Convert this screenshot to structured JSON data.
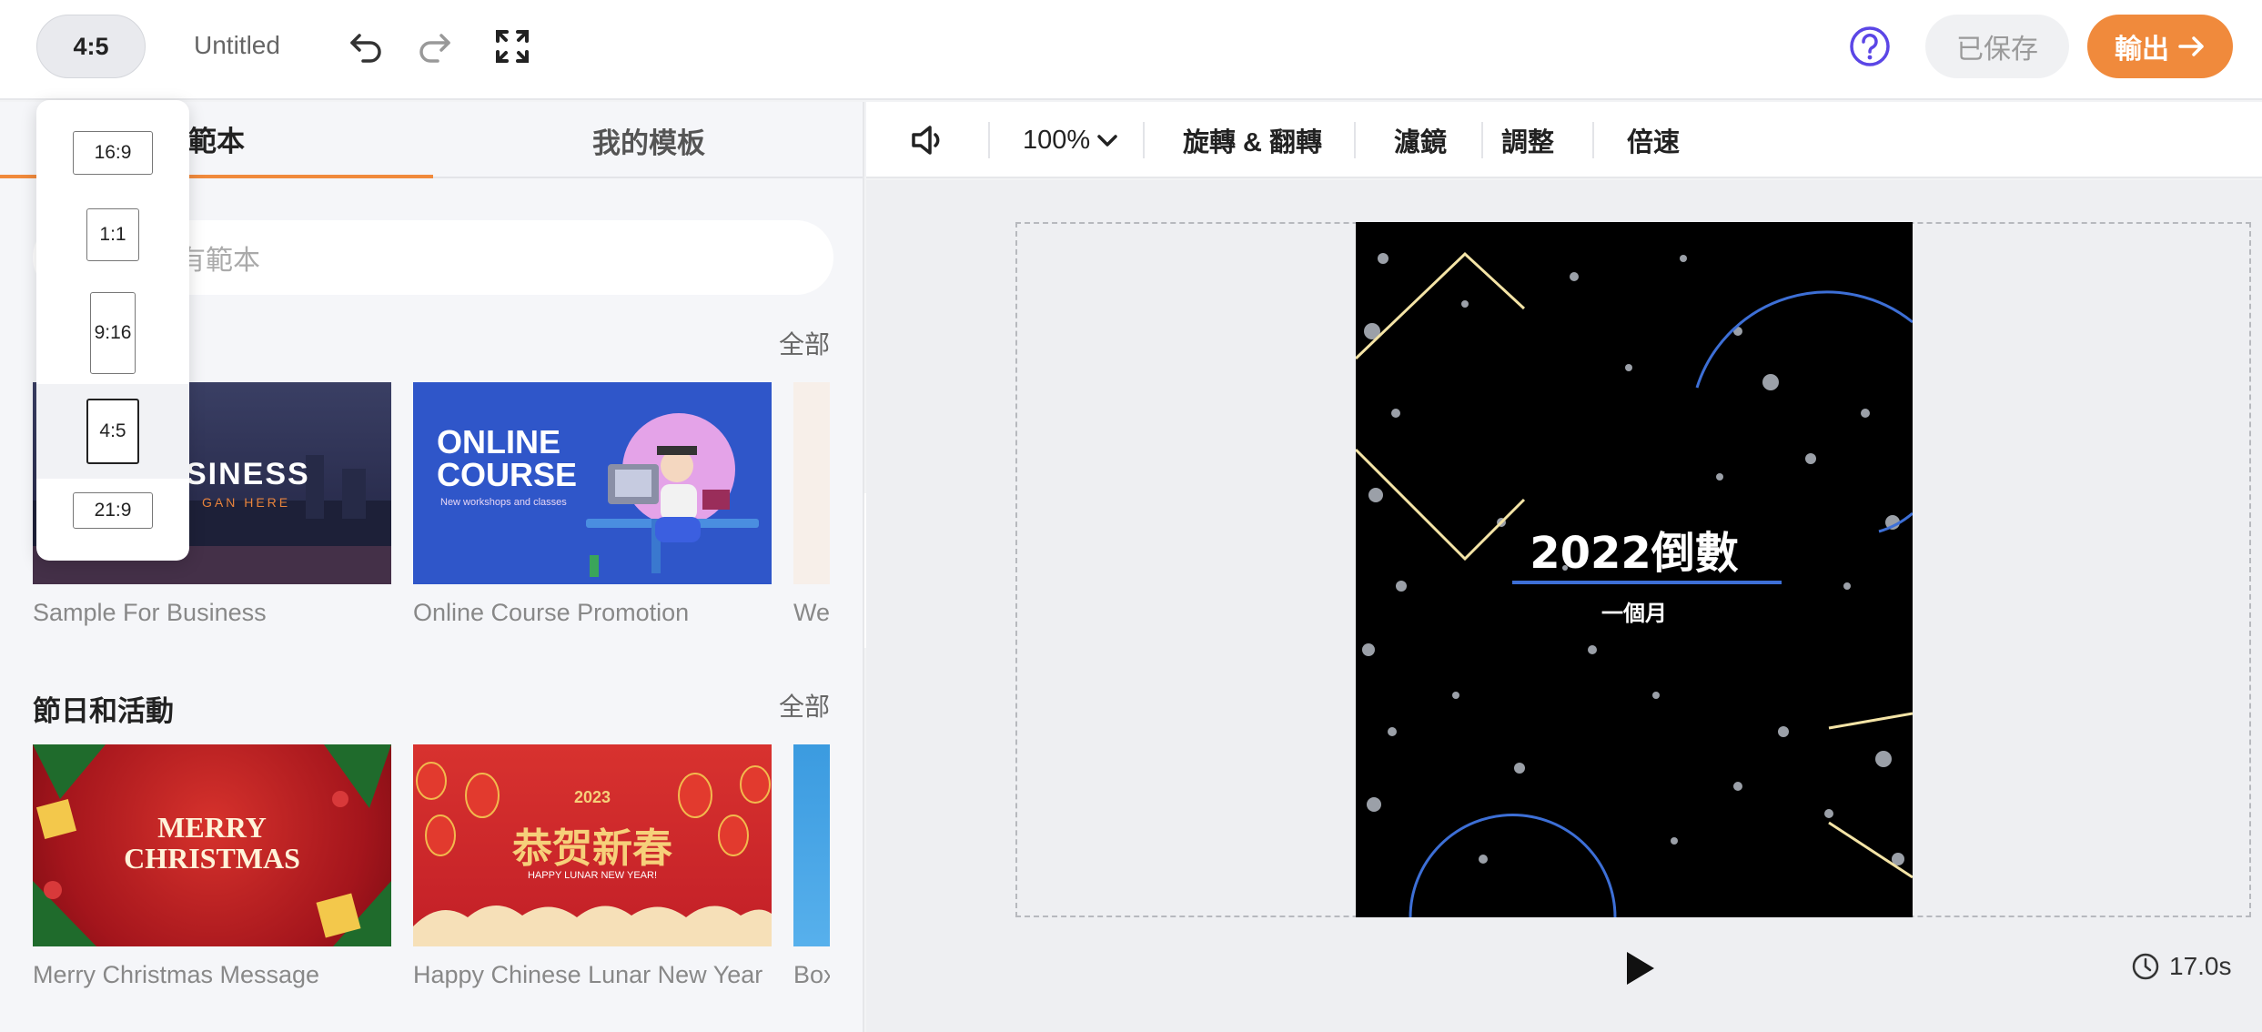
{
  "topbar": {
    "aspect_ratio": "4:5",
    "doc_title": "Untitled",
    "saved_label": "已保存",
    "export_label": "輸出",
    "accent_color": "#f08a3c",
    "help_color": "#5b46e6"
  },
  "ratio_menu": {
    "options": [
      "16:9",
      "1:1",
      "9:16",
      "4:5",
      "21:9"
    ],
    "selected": "4:5"
  },
  "left_panel": {
    "tabs": [
      {
        "label": "範本",
        "active": true
      },
      {
        "label": "我的模板",
        "active": false
      }
    ],
    "search_placeholder": "有範本",
    "sections": [
      {
        "title": "",
        "see_all": "全部",
        "cards": [
          {
            "label": "Sample For Business",
            "thumb_lines": [
              "SINESS",
              "GAN HERE"
            ]
          },
          {
            "label": "Online Course Promotion",
            "thumb_lines": [
              "ONLINE",
              "COURSE",
              "New workshops and classes"
            ]
          },
          {
            "label": "Wei"
          }
        ]
      },
      {
        "title": "節日和活動",
        "see_all": "全部",
        "cards": [
          {
            "label": "Merry Christmas Message",
            "thumb_lines": [
              "MERRY",
              "CHRISTMAS"
            ]
          },
          {
            "label": "Happy Chinese Lunar New Year ...",
            "thumb_lines": [
              "2023",
              "恭贺新春",
              "HAPPY LUNAR NEW YEAR!"
            ]
          },
          {
            "label": "Box"
          }
        ]
      }
    ]
  },
  "edit_toolbar": {
    "zoom": "100%",
    "items": [
      "旋轉 & 翻轉",
      "濾鏡",
      "調整",
      "倍速"
    ]
  },
  "canvas": {
    "video_title": "2022倒數",
    "video_subtitle": "一個月",
    "duration": "17.0s"
  }
}
